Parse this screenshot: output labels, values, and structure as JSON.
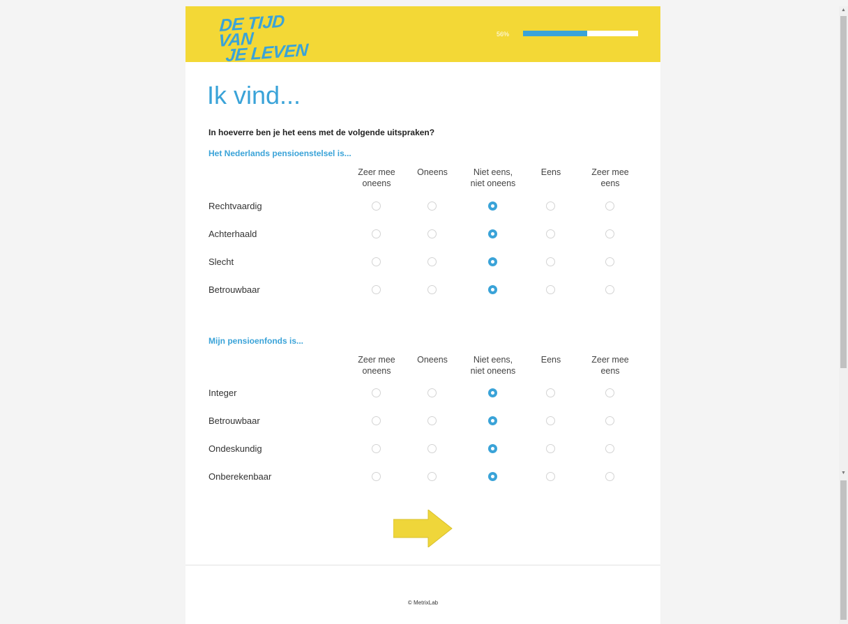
{
  "header": {
    "logo_line1": "DE TIJD VAN",
    "logo_line2": "JE LEVEN",
    "progress_label": "56%",
    "progress_value": 0.56
  },
  "page": {
    "title": "Ik vind...",
    "question": "In hoeverre ben je het eens met de volgende uitspraken?"
  },
  "columns": [
    {
      "line1": "Zeer mee",
      "line2": "oneens"
    },
    {
      "line1": "Oneens",
      "line2": ""
    },
    {
      "line1": "Niet eens,",
      "line2": "niet oneens"
    },
    {
      "line1": "Eens",
      "line2": ""
    },
    {
      "line1": "Zeer mee",
      "line2": "eens"
    }
  ],
  "sections": [
    {
      "title": "Het Nederlands pensioenstelsel is...",
      "rows": [
        {
          "label": "Rechtvaardig",
          "selected": 2
        },
        {
          "label": "Achterhaald",
          "selected": 2
        },
        {
          "label": "Slecht",
          "selected": 2
        },
        {
          "label": "Betrouwbaar",
          "selected": 2
        }
      ]
    },
    {
      "title": "Mijn pensioenfonds is...",
      "rows": [
        {
          "label": "Integer",
          "selected": 2
        },
        {
          "label": "Betrouwbaar",
          "selected": 2
        },
        {
          "label": "Ondeskundig",
          "selected": 2
        },
        {
          "label": "Onberekenbaar",
          "selected": 2
        }
      ]
    }
  ],
  "footer": {
    "copyright": "© MetrixLab"
  },
  "colors": {
    "accent_blue": "#3aa3d8",
    "header_yellow": "#f3d836",
    "arrow_yellow": "#efd63a"
  }
}
